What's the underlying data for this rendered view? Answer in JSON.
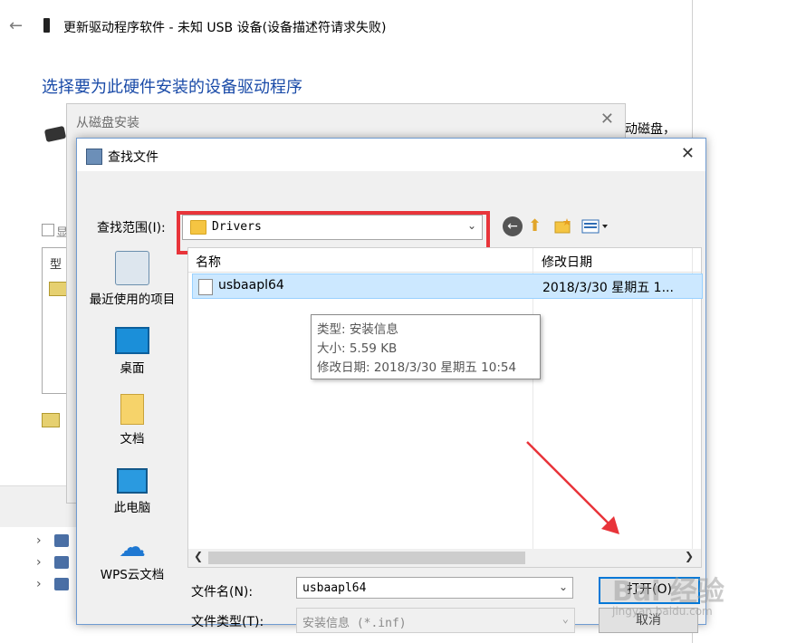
{
  "wizard": {
    "title": "更新驱动程序软件 - 未知 USB 设备(设备描述符请求失败)",
    "heading": "选择要为此硬件安装的设备驱动程序",
    "partial_right": "动磁盘，",
    "partial_check": "显",
    "partial_model": "型"
  },
  "disk_dialog": {
    "title": "从磁盘安装"
  },
  "find_dialog": {
    "title": "查找文件",
    "look_in_label": "查找范围(I):",
    "look_in_value": "Drivers",
    "places": [
      {
        "label": "最近使用的项目",
        "icon": "recent-items-icon"
      },
      {
        "label": "桌面",
        "icon": "desktop-icon"
      },
      {
        "label": "文档",
        "icon": "documents-icon"
      },
      {
        "label": "此电脑",
        "icon": "this-pc-icon"
      },
      {
        "label": "WPS云文档",
        "icon": "cloud-icon"
      }
    ],
    "columns": {
      "name": "名称",
      "modified": "修改日期"
    },
    "files": [
      {
        "name": "usbaapl64",
        "modified": "2018/3/30 星期五 1..."
      }
    ],
    "tooltip": {
      "type": "类型: 安装信息",
      "size": "大小: 5.59 KB",
      "modified": "修改日期: 2018/3/30 星期五 10:54"
    },
    "file_name_label": "文件名(N):",
    "file_name_value": "usbaapl64",
    "file_type_label": "文件类型(T):",
    "file_type_value": "安装信息 (*.inf)",
    "open_label": "打开(O)",
    "cancel_label": "取消"
  },
  "watermark": {
    "text": "Bai 经验",
    "url": "jingyan.baidu.com"
  },
  "colors": {
    "accent": "#0078d7",
    "highlight": "#e8343a",
    "selection": "#cce8ff",
    "heading": "#1a4ba8"
  }
}
